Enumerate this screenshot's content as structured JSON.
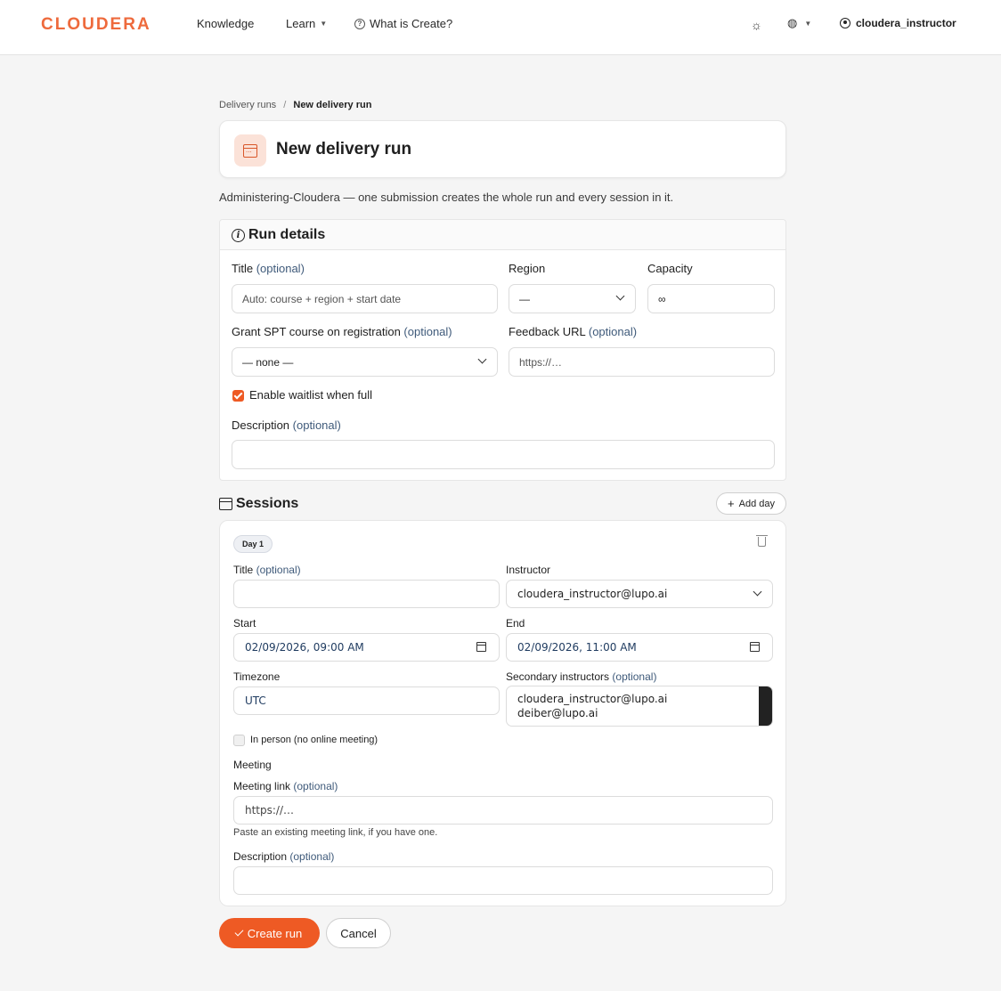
{
  "nav": {
    "logo": "CLOUDERA",
    "knowledge": "Knowledge",
    "learn": "Learn",
    "what_is_create": "What is Create?",
    "username": "cloudera_instructor"
  },
  "breadcrumb": {
    "parent": "Delivery runs",
    "separator": "/",
    "current": "New delivery run"
  },
  "header": {
    "title": "New delivery run",
    "subtitle": "Administering-Cloudera — one submission creates the whole run and every session in it."
  },
  "run_details": {
    "heading": "Run details",
    "title_label": "Title",
    "title_optional": "(optional)",
    "title_placeholder": "Auto: course + region + start date",
    "region_label": "Region",
    "region_value": "—",
    "capacity_label": "Capacity",
    "capacity_placeholder": "∞",
    "grant_label": "Grant SPT course on registration",
    "grant_optional": "(optional)",
    "grant_value": "— none —",
    "feedback_label": "Feedback URL",
    "feedback_optional": "(optional)",
    "feedback_placeholder": "https://…",
    "waitlist_label": "Enable waitlist when full",
    "waitlist_checked": true,
    "description_label": "Description",
    "description_optional": "(optional)"
  },
  "sessions": {
    "heading": "Sessions",
    "add_day": "Add day",
    "day": {
      "badge": "Day 1",
      "title_label": "Title",
      "title_optional": "(optional)",
      "instructor_label": "Instructor",
      "instructor_value": "cloudera_instructor@lupo.ai",
      "start_label": "Start",
      "start_value": "02/09/2026, 09:00 AM",
      "end_label": "End",
      "end_value": "02/09/2026, 11:00 AM",
      "timezone_label": "Timezone",
      "timezone_value": "UTC",
      "secondary_label": "Secondary instructors",
      "secondary_optional": "(optional)",
      "secondary_options": [
        "cloudera_instructor@lupo.ai",
        "deiber@lupo.ai"
      ],
      "in_person_label": "In person (no online meeting)",
      "in_person_checked": false,
      "meeting_heading": "Meeting",
      "meeting_link_label": "Meeting link",
      "meeting_link_optional": "(optional)",
      "meeting_link_placeholder": "https://…",
      "meeting_help": "Paste an existing meeting link, if you have one.",
      "description_label": "Description",
      "description_optional": "(optional)"
    }
  },
  "actions": {
    "create": "Create run",
    "cancel": "Cancel"
  },
  "colors": {
    "accent": "#ee5a24",
    "logo": "#ee6a3c"
  }
}
